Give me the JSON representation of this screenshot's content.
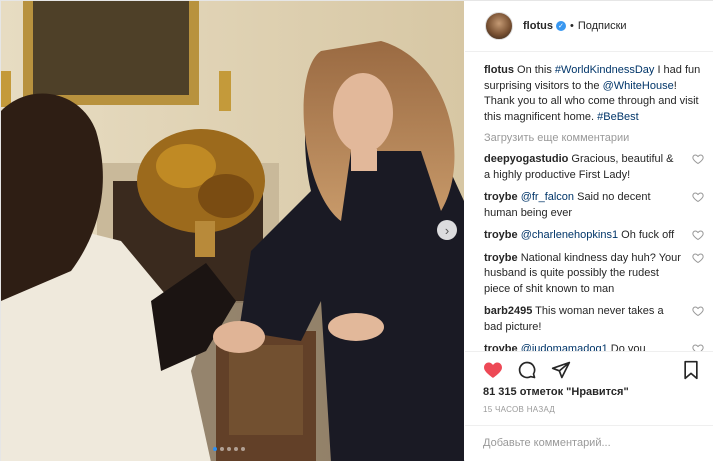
{
  "header": {
    "username": "flotus",
    "follow_label": "Подписки",
    "bullet": "•"
  },
  "caption": {
    "username": "flotus",
    "text_1": "On this ",
    "hashtag_1": "#WorldKindnessDay",
    "text_2": " I had fun surprising visitors to the ",
    "mention_1": "@WhiteHouse",
    "text_3": "! Thank you to all who come through and visit this magnificent home. ",
    "hashtag_2": "#BeBest"
  },
  "load_more_label": "Загрузить еще комментарии",
  "comments": [
    {
      "username": "deepyogastudio",
      "mention": "",
      "text": "Gracious, beautiful & a highly productive First Lady!"
    },
    {
      "username": "troybe",
      "mention": "@fr_falcon",
      "text": " Said no decent human being ever"
    },
    {
      "username": "troybe",
      "mention": "@charlenehopkins1",
      "text": " Oh fuck off"
    },
    {
      "username": "troybe",
      "mention": "",
      "text": "National kindness day huh? Your husband is quite possibly the rudest piece of shit known to man"
    },
    {
      "username": "barb2495",
      "mention": "",
      "text": "This woman never takes a bad picture!"
    },
    {
      "username": "troybe",
      "mention": "@judomamadog1",
      "text": " Do you seriously not hear what comes out of Trumps mouth every single fucking"
    }
  ],
  "likes_text": "81 315 отметок \"Нравится\"",
  "time_ago": "15 часов назад",
  "add_comment_placeholder": "Добавьте комментарий...",
  "carousel": {
    "next_glyph": "›",
    "active_index": 0,
    "count": 5
  },
  "colors": {
    "like_red": "#ed4956",
    "link_blue": "#003569",
    "verified_blue": "#3897f0",
    "muted_gray": "#999999"
  },
  "icons": [
    "heart-icon",
    "comment-icon",
    "share-icon",
    "bookmark-icon",
    "verified-icon",
    "chevron-right-icon"
  ]
}
